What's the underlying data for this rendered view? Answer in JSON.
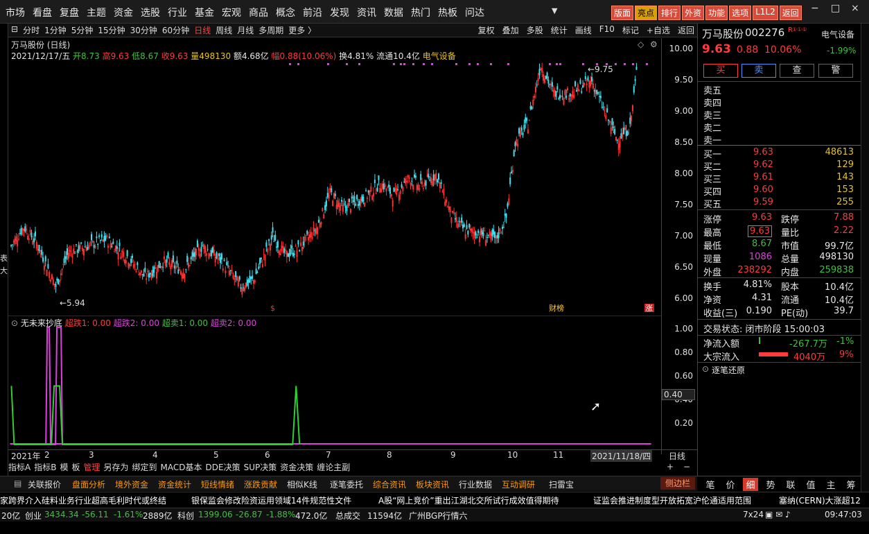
{
  "top_menu": [
    "市场",
    "看盘",
    "复盘",
    "主题",
    "资金",
    "选股",
    "行业",
    "基金",
    "宏观",
    "商品",
    "概念",
    "前沿",
    "发现",
    "资讯",
    "数据",
    "热门",
    "热板",
    "问达"
  ],
  "top_right_buttons": [
    "版面",
    "亮点",
    "排行",
    "外资",
    "功能",
    "选项",
    "L1L2",
    "返回"
  ],
  "window_controls": [
    "−",
    "□",
    "×"
  ],
  "period_tabs": [
    "分时",
    "1分钟",
    "5分钟",
    "15分钟",
    "30分钟",
    "60分钟",
    "日线",
    "周线",
    "月线",
    "多周期",
    "更多 〉"
  ],
  "active_period": "日线",
  "tool_tabs": [
    "复权",
    "叠加",
    "多股",
    "统计",
    "画线",
    "F10",
    "标记",
    "+自选",
    "返回"
  ],
  "stock": {
    "title": "万马股份 (日线)",
    "date": "2021/12/17/五",
    "open_label": "开8.73",
    "high_label": "高9.63",
    "low_label": "低8.67",
    "close_label": "收9.63",
    "volume_label": "量498130",
    "amount_label": "额4.68亿",
    "change_label": "幅0.88(10.06%)",
    "turnover_label": "换4.81%",
    "float_label": "流通10.4亿",
    "sector": "电气设备",
    "high_mark": "9.75",
    "low_mark": "5.94"
  },
  "price_axis": [
    "10.00",
    "9.50",
    "9.00",
    "8.50",
    "8.00",
    "7.50",
    "7.00",
    "6.50",
    "6.00"
  ],
  "indicator": {
    "name": "无未来抄底",
    "items": [
      "超跌1: 0.00",
      "超跌2: 0.00",
      "超卖1: 0.00",
      "超卖2: 0.00"
    ],
    "axis": [
      "1.00",
      "0.80",
      "0.60",
      "0.40",
      "0.20"
    ],
    "cursor_value": "0.40"
  },
  "chart_markers": {
    "s_marker": "$",
    "bang_marker": "财榜",
    "zhang_marker": "涨"
  },
  "x_axis": [
    "2021年",
    "2",
    "3",
    "4",
    "5",
    "6",
    "7",
    "8",
    "9",
    "10",
    "11",
    "2021/11/18/四"
  ],
  "x_axis_right": "日线",
  "bottom_tabs": [
    "指标A",
    "指标B",
    "模",
    "板",
    "管理",
    "另存为",
    "绑定到",
    "MACD基本",
    "DDE决策",
    "SUP决策",
    "资金决策",
    "缠论主副"
  ],
  "bottom_tabs_active": "管理",
  "bottom_controls": [
    "+",
    "−"
  ],
  "function_bar": [
    "关联报价",
    "盘面分析",
    "境外资金",
    "资金统计",
    "短线情绪",
    "涨跌贡献",
    "相似K线",
    "逐笔委托",
    "综合资讯",
    "板块资讯",
    "行业数据",
    "互动调研",
    "扫雷宝"
  ],
  "sidebar_label": "侧边栏",
  "right_panel": {
    "name": "万马股份",
    "code": "002276",
    "badge": "R",
    "sector": "电气设备",
    "sector_change": "-1.99%",
    "price": "9.63",
    "change": "0.88",
    "pct": "10.06%",
    "buttons": [
      "买",
      "卖",
      "查",
      "警"
    ],
    "sell_levels": [
      "卖五",
      "卖四",
      "卖三",
      "卖二",
      "卖一"
    ],
    "buy_levels": [
      {
        "label": "买一",
        "price": "9.63",
        "vol": "48613"
      },
      {
        "label": "买二",
        "price": "9.62",
        "vol": "129"
      },
      {
        "label": "买三",
        "price": "9.61",
        "vol": "143"
      },
      {
        "label": "买四",
        "price": "9.60",
        "vol": "153"
      },
      {
        "label": "买五",
        "price": "9.59",
        "vol": "255"
      }
    ],
    "stats": [
      {
        "l1": "涨停",
        "v1": "9.63",
        "l2": "跌停",
        "v2": "7.88"
      },
      {
        "l1": "最高",
        "v1": "9.63",
        "l2": "量比",
        "v2": "2.22"
      },
      {
        "l1": "最低",
        "v1": "8.67",
        "l2": "市值",
        "v2": "99.7亿"
      },
      {
        "l1": "现量",
        "v1": "1086",
        "l2": "总量",
        "v2": "498130"
      },
      {
        "l1": "外盘",
        "v1": "238292",
        "l2": "内盘",
        "v2": "259838"
      }
    ],
    "stats2": [
      {
        "l1": "换手",
        "v1": "4.81%",
        "l2": "股本",
        "v2": "10.4亿"
      },
      {
        "l1": "净资",
        "v1": "4.31",
        "l2": "流通",
        "v2": "10.4亿"
      },
      {
        "l1": "收益(三)",
        "v1": "0.190",
        "l2": "PE(动)",
        "v2": "39.7"
      }
    ],
    "trade_status": "交易状态: 闭市阶段 15:00:03",
    "net_inflow_label": "净流入额",
    "net_inflow": "-267.7万",
    "net_inflow_pct": "-1%",
    "block_label": "大宗流入",
    "block_value": "4040万",
    "block_pct": "9%",
    "restore_label": "逐笔还原",
    "bottom_tabs": [
      "笔",
      "价",
      "细",
      "势",
      "联",
      "值",
      "主",
      "筹"
    ],
    "bottom_active": "细"
  },
  "news": [
    "家跨界介入硅料业务行业超高毛利时代或终结",
    "银保监会修改险资运用领域14件规范性文件",
    "A股“网上竞价”重出江湖北交所试行成效值得期待",
    "证监会推进制度型开放拓宽沪伦通适用范围",
    "塞纳(CERN)大涨超12"
  ],
  "status_bar": {
    "left": "20亿",
    "cy_label": "创业",
    "cy_value": "3434.34",
    "cy_change": "-56.11",
    "cy_pct": "-1.61%",
    "cy_amount": "2889亿",
    "kc_label": "科创",
    "kc_value": "1399.06",
    "kc_change": "-26.87",
    "kc_pct": "-1.88%",
    "kc_amount": "472.0亿",
    "total_label": "总成交",
    "total_value": "11594亿",
    "market": "广州BGP行情六",
    "grid": "7x24",
    "time": "09:47:03"
  }
}
